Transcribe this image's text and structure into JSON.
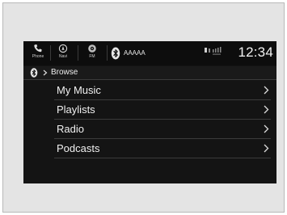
{
  "status_bar": {
    "phone_label": "Phone",
    "navi_label": "Navi",
    "fm_label": "FM",
    "device_name": "AAAAA",
    "clock": "12:34",
    "icons": [
      "phone-icon",
      "navi-icon",
      "fm-icon",
      "bluetooth-icon",
      "signal-icon"
    ]
  },
  "breadcrumb": {
    "icon": "bluetooth-icon",
    "separator_icon": "chevron-right-icon",
    "text": "Browse"
  },
  "menu": {
    "items": [
      {
        "label": "My Music"
      },
      {
        "label": "Playlists"
      },
      {
        "label": "Radio"
      },
      {
        "label": "Podcasts"
      }
    ]
  }
}
